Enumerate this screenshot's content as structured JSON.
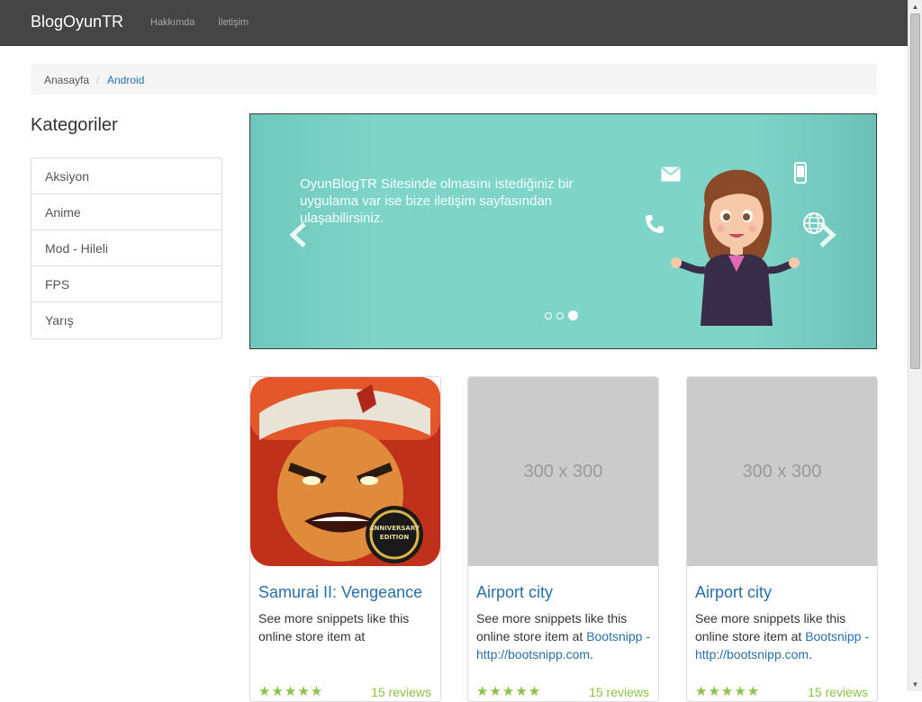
{
  "navbar": {
    "brand": "BlogOyunTR",
    "links": [
      "Hakkımda",
      "İletişim"
    ]
  },
  "breadcrumb": {
    "home": "Anasayfa",
    "separator": "/",
    "active": "Android"
  },
  "sidebar": {
    "title": "Kategoriler",
    "items": [
      "Aksiyon",
      "Anime",
      "Mod - Hileli",
      "FPS",
      "Yarış"
    ]
  },
  "carousel": {
    "text": "OyunBlogTR Sitesinde olmasını istediğiniz bir uygulama var ise bize iletişim sayfasından ulaşabilirsiniz.",
    "prev_icon": "chevron-left-icon",
    "next_icon": "chevron-right-icon",
    "slide_count": 3,
    "active_slide": 3,
    "background": "#7fd4c8"
  },
  "products": [
    {
      "title": "Samurai II: Vengeance",
      "image_placeholder": "",
      "badge": "ANNIVERSARY EDITION",
      "desc": "See more snippets like this online store item at",
      "link_text": "",
      "reviews": "15 reviews",
      "rating": 5
    },
    {
      "title": "Airport city",
      "image_placeholder": "300 x 300",
      "desc": "See more snippets like this online store item at",
      "link_text": "Bootsnipp - http://bootsnipp.com",
      "reviews": "15 reviews",
      "rating": 5
    },
    {
      "title": "Airport city",
      "image_placeholder": "300 x 300",
      "desc": "See more snippets like this online store item at",
      "link_text": "Bootsnipp - http://bootsnipp.com",
      "reviews": "15 reviews",
      "rating": 5
    }
  ],
  "colors": {
    "navbar": "#454545",
    "link": "#2a6fa8",
    "stars": "#8bc34a",
    "placeholder": "#cbcbcb"
  }
}
